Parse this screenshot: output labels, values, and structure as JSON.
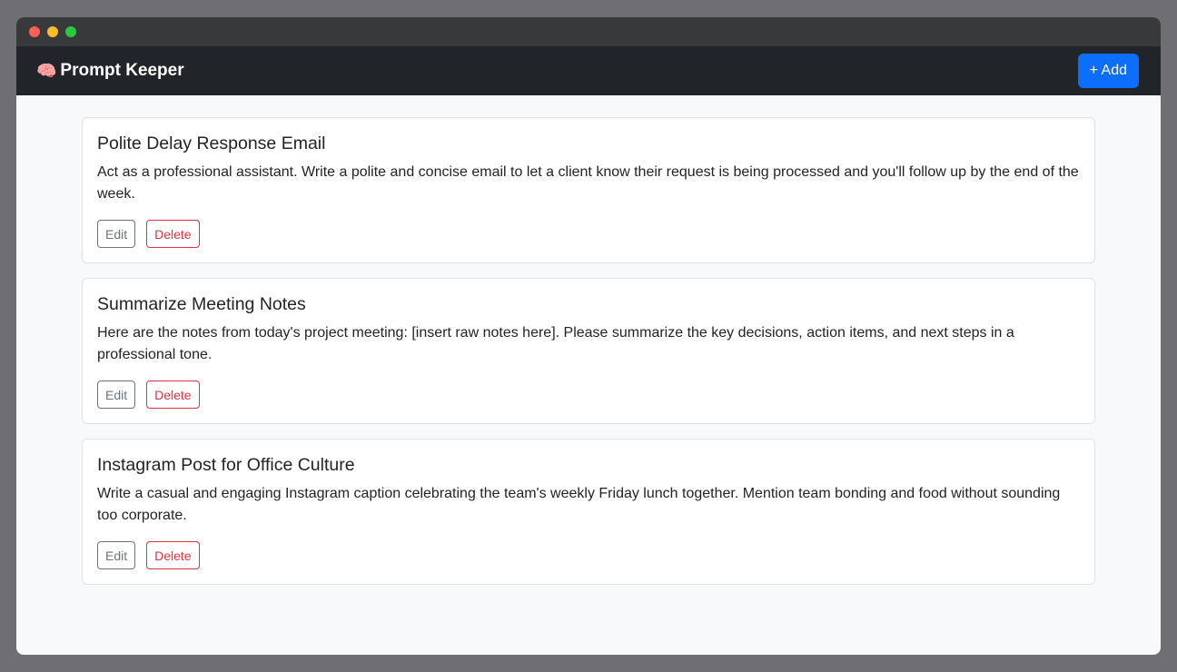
{
  "app": {
    "brand_icon": "🧠",
    "title": "Prompt Keeper",
    "add_label": "+ Add"
  },
  "prompts": [
    {
      "title": "Polite Delay Response Email",
      "text": "Act as a professional assistant. Write a polite and concise email to let a client know their request is being processed and you'll follow up by the end of the week.",
      "edit_label": "Edit",
      "delete_label": "Delete"
    },
    {
      "title": "Summarize Meeting Notes",
      "text": "Here are the notes from today's project meeting: [insert raw notes here]. Please summarize the key decisions, action items, and next steps in a professional tone.",
      "edit_label": "Edit",
      "delete_label": "Delete"
    },
    {
      "title": "Instagram Post for Office Culture",
      "text": "Write a casual and engaging Instagram caption celebrating the team's weekly Friday lunch together. Mention team bonding and food without sounding too corporate.",
      "edit_label": "Edit",
      "delete_label": "Delete"
    }
  ],
  "colors": {
    "navbar": "#212529",
    "primary": "#0d6efd",
    "danger": "#dc3545",
    "secondary": "#6c757d"
  }
}
